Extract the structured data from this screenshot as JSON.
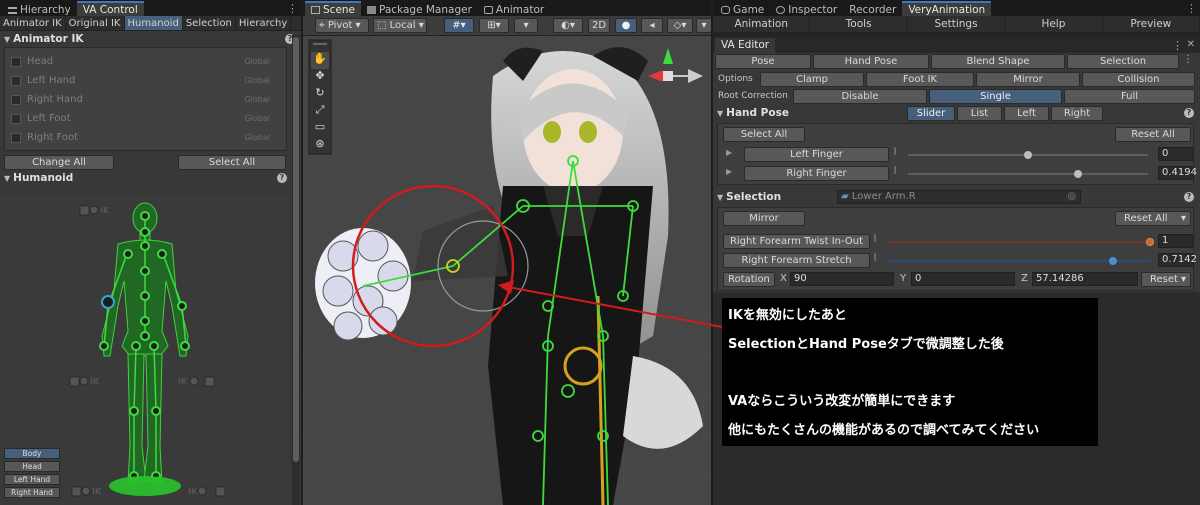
{
  "left_panel": {
    "tabs": [
      "Hierarchy",
      "VA Control"
    ],
    "subtabs": [
      "Animator IK",
      "Original IK",
      "Humanoid",
      "Selection",
      "Hierarchy"
    ],
    "animator_ik": {
      "title": "Animator IK",
      "rows": [
        {
          "label": "Head",
          "space": "Global"
        },
        {
          "label": "Left Hand",
          "space": "Global"
        },
        {
          "label": "Right Hand",
          "space": "Global"
        },
        {
          "label": "Left Foot",
          "space": "Global"
        },
        {
          "label": "Right Foot",
          "space": "Global"
        }
      ],
      "change_all": "Change All",
      "select_all": "Select All"
    },
    "humanoid": {
      "title": "Humanoid",
      "ik_label": "IK",
      "buttons": [
        "Body",
        "Head",
        "Left Hand",
        "Right Hand"
      ]
    }
  },
  "scene": {
    "tabs": [
      "Scene",
      "Package Manager",
      "Animator"
    ],
    "toolbar": {
      "pivot": "Pivot",
      "local": "Local",
      "mode2d": "2D"
    }
  },
  "right_panel": {
    "tabs": [
      "Game",
      "Inspector",
      "Recorder",
      "VeryAnimation"
    ],
    "menu": [
      "Animation",
      "Tools",
      "Settings",
      "Help",
      "Preview"
    ],
    "editor_title": "VA Editor",
    "mode_tabs": [
      "Pose",
      "Hand Pose",
      "Blend Shape",
      "Selection"
    ],
    "options_label": "Options",
    "options": [
      "Clamp",
      "Foot IK",
      "Mirror",
      "Collision"
    ],
    "root_correction_label": "Root Correction",
    "root_correction": [
      "Disable",
      "Single",
      "Full"
    ],
    "hand_pose": {
      "title": "Hand Pose",
      "view_tabs": [
        "Slider",
        "List",
        "Left",
        "Right"
      ],
      "select_all": "Select All",
      "reset_all": "Reset All",
      "fingers": [
        {
          "label": "Left Finger",
          "value": "0",
          "frac": 0.5
        },
        {
          "label": "Right Finger",
          "value": "0.4194",
          "frac": 0.71
        }
      ]
    },
    "selection": {
      "title": "Selection",
      "object": "Lower Arm.R",
      "mirror": "Mirror",
      "reset_all": "Reset All",
      "params": [
        {
          "label": "Right Forearm Twist In-Out",
          "value": "1",
          "frac": 1.0,
          "color": "#c46a3a"
        },
        {
          "label": "Right Forearm Stretch",
          "value": "0.7142",
          "frac": 0.86,
          "color": "#4b8fd6"
        }
      ],
      "rotation_label": "Rotation",
      "rotation": {
        "x_label": "X",
        "x": "90",
        "y_label": "Y",
        "y": "0",
        "z_label": "Z",
        "z": "57.14286"
      },
      "reset": "Reset"
    }
  },
  "annotation": {
    "lines": [
      "IKを無効にしたあと",
      "SelectionとHand Poseタブで微調整した後",
      "VAならこういう改変が簡単にできます",
      "他にもたくさんの機能があるので調べてみてください"
    ]
  },
  "colors": {
    "accent": "#46607c",
    "active_tab": "#3a79bb",
    "bone_green": "#3ddc3d",
    "annotation_red": "#d01c1c",
    "slider_orange": "#c46a3a",
    "slider_blue": "#4b8fd6"
  }
}
